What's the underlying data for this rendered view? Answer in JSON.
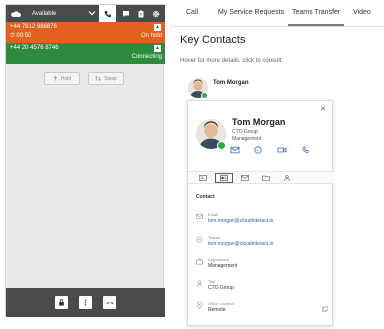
{
  "softphone": {
    "status": "Available",
    "calls": [
      {
        "number": "+44 7812 986876",
        "timer": "00:50",
        "state": "On hold"
      },
      {
        "number": "+44 20 4576 8746",
        "state": "Connecting"
      }
    ],
    "controls": {
      "hold": "Hold",
      "swap": "Swap"
    },
    "colors": {
      "hold_call": "#e0621e",
      "active_call": "#2e8b3e",
      "bar": "#4a4a4a"
    }
  },
  "tabs": [
    "Call",
    "My Service Requests",
    "Teams Transfer",
    "Video"
  ],
  "active_tab": "Teams Transfer",
  "key_contacts": {
    "title": "Key Contacts",
    "hint": "Hover for more details, click to consult.",
    "contact_name": "Tom Morgan"
  },
  "card": {
    "name": "Tom Morgan",
    "title": "CTO Group",
    "department": "Management",
    "section": "Contact",
    "fields": [
      {
        "label": "Email",
        "value": "tom.morgan@cloudinteract.io"
      },
      {
        "label": "Teams",
        "value": "tom.morgan@cloudinteract.io"
      },
      {
        "label": "Department",
        "value": "Management"
      },
      {
        "label": "Title",
        "value": "CTO Group"
      },
      {
        "label": "Office Location",
        "value": "Remote"
      }
    ]
  }
}
